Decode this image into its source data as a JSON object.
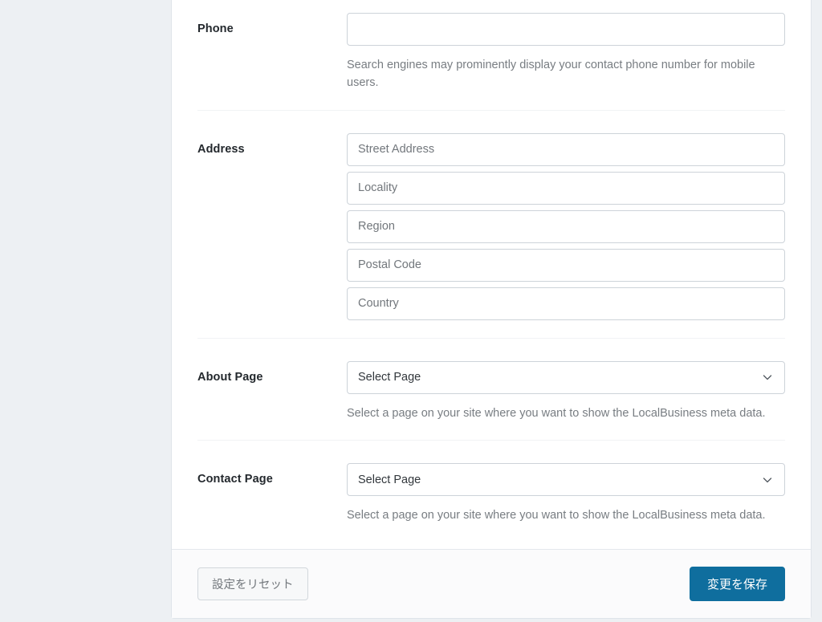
{
  "settings_sections": [
    {
      "label": "Phone",
      "field_type": "text",
      "value": "",
      "placeholder": "",
      "description": "Search engines may prominently display your contact phone number for mobile users."
    },
    {
      "label": "Address",
      "field_type": "text-stack",
      "fields": [
        {
          "name": "street-address",
          "value": "",
          "placeholder": "Street Address"
        },
        {
          "name": "locality",
          "value": "",
          "placeholder": "Locality"
        },
        {
          "name": "region",
          "value": "",
          "placeholder": "Region"
        },
        {
          "name": "postal-code",
          "value": "",
          "placeholder": "Postal Code"
        },
        {
          "name": "country",
          "value": "",
          "placeholder": "Country"
        }
      ],
      "description": ""
    },
    {
      "label": "About Page",
      "field_type": "select",
      "selected": "Select Page",
      "icon": "chevron-down-icon",
      "description": "Select a page on your site where you want to show the LocalBusiness meta data."
    },
    {
      "label": "Contact Page",
      "field_type": "select",
      "selected": "Select Page",
      "icon": "chevron-down-icon",
      "description": "Select a page on your site where you want to show the LocalBusiness meta data."
    }
  ],
  "footer": {
    "reset_label": "設定をリセット",
    "save_label": "変更を保存"
  },
  "colors": {
    "page_background": "#edf0f3",
    "card_background": "#ffffff",
    "save_button": "#0f6e9e",
    "label_text": "#23282d",
    "description_text": "#787d82",
    "input_border": "#cdd3d9"
  }
}
